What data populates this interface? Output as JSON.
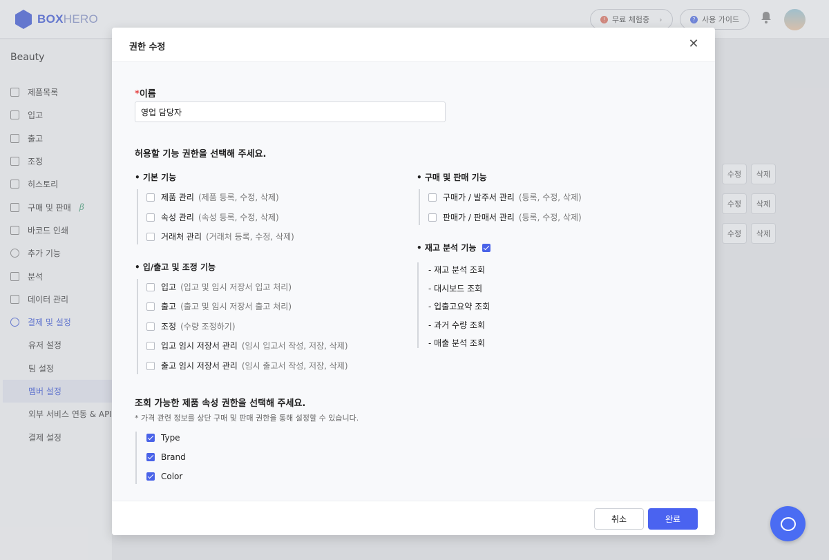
{
  "brand": {
    "logo_text": "BOXHERO",
    "logo_a": "BOX",
    "logo_b": "HERO"
  },
  "topbar": {
    "trial_label": "무료 체험중",
    "guide_label": "사용 가이드"
  },
  "sidebar": {
    "workspace": "Beauty",
    "items": [
      {
        "label": "제품목록"
      },
      {
        "label": "입고"
      },
      {
        "label": "출고"
      },
      {
        "label": "조정"
      },
      {
        "label": "히스토리"
      },
      {
        "label": "구매 및 판매",
        "badge": "β"
      },
      {
        "label": "바코드 인쇄"
      },
      {
        "label": "추가 기능"
      },
      {
        "label": "분석"
      },
      {
        "label": "데이터 관리"
      },
      {
        "label": "결제 및 설정"
      }
    ],
    "sub_items": [
      {
        "label": "유저 설정"
      },
      {
        "label": "팀 설정"
      },
      {
        "label": "멤버 설정"
      },
      {
        "label": "외부 서비스 연동 & API"
      },
      {
        "label": "결제 설정"
      }
    ]
  },
  "background_rows": {
    "edit_label": "수정",
    "delete_label": "삭제"
  },
  "modal": {
    "title": "권한 수정",
    "name_label": "이름",
    "name_required_mark": "*",
    "name_value": "영업 담당자",
    "section1_title": "허용할 기능 권한을 선택해 주세요.",
    "groups": {
      "basic": {
        "title": "• 기본 기능",
        "options": [
          {
            "label": "제품 관리",
            "hint": "(제품 등록, 수정, 삭제)",
            "checked": false
          },
          {
            "label": "속성 관리",
            "hint": "(속성 등록, 수정, 삭제)",
            "checked": false
          },
          {
            "label": "거래처 관리",
            "hint": "(거래처 등록, 수정, 삭제)",
            "checked": false
          }
        ]
      },
      "inout": {
        "title": "• 입/출고 및 조정 기능",
        "options": [
          {
            "label": "입고",
            "hint": "(입고 및 임시 저장서 입고 처리)",
            "checked": false
          },
          {
            "label": "출고",
            "hint": "(출고 및 임시 저장서 출고 처리)",
            "checked": false
          },
          {
            "label": "조정",
            "hint": "(수량 조정하기)",
            "checked": false
          },
          {
            "label": "입고 임시 저장서 관리",
            "hint": "(임시 입고서 작성, 저장, 삭제)",
            "checked": false
          },
          {
            "label": "출고 임시 저장서 관리",
            "hint": "(임시 출고서 작성, 저장, 삭제)",
            "checked": false
          }
        ]
      },
      "purchase": {
        "title": "• 구매 및 판매 기능",
        "options": [
          {
            "label": "구매가 / 발주서 관리",
            "hint": "(등록, 수정, 삭제)",
            "checked": false
          },
          {
            "label": "판매가 / 판매서 관리",
            "hint": "(등록, 수정, 삭제)",
            "checked": false
          }
        ]
      },
      "analysis": {
        "title": "• 재고 분석 기능",
        "checked": true,
        "items": [
          "- 재고 분석 조회",
          "- 대시보드 조회",
          "- 입출고요약 조회",
          "- 과거 수량 조회",
          "- 매출 분석 조회"
        ]
      }
    },
    "section2_title": "조회 가능한 제품 속성 권한을 선택해 주세요.",
    "section2_note": "* 가격 관련 정보를 상단 구매 및 판매 권한을 통해 설정할 수 있습니다.",
    "attributes": [
      {
        "label": "Type",
        "checked": true
      },
      {
        "label": "Brand",
        "checked": true
      },
      {
        "label": "Color",
        "checked": true
      }
    ],
    "cancel_label": "취소",
    "confirm_label": "완료"
  },
  "colors": {
    "accent": "#4a63f0",
    "required": "#e54545"
  }
}
